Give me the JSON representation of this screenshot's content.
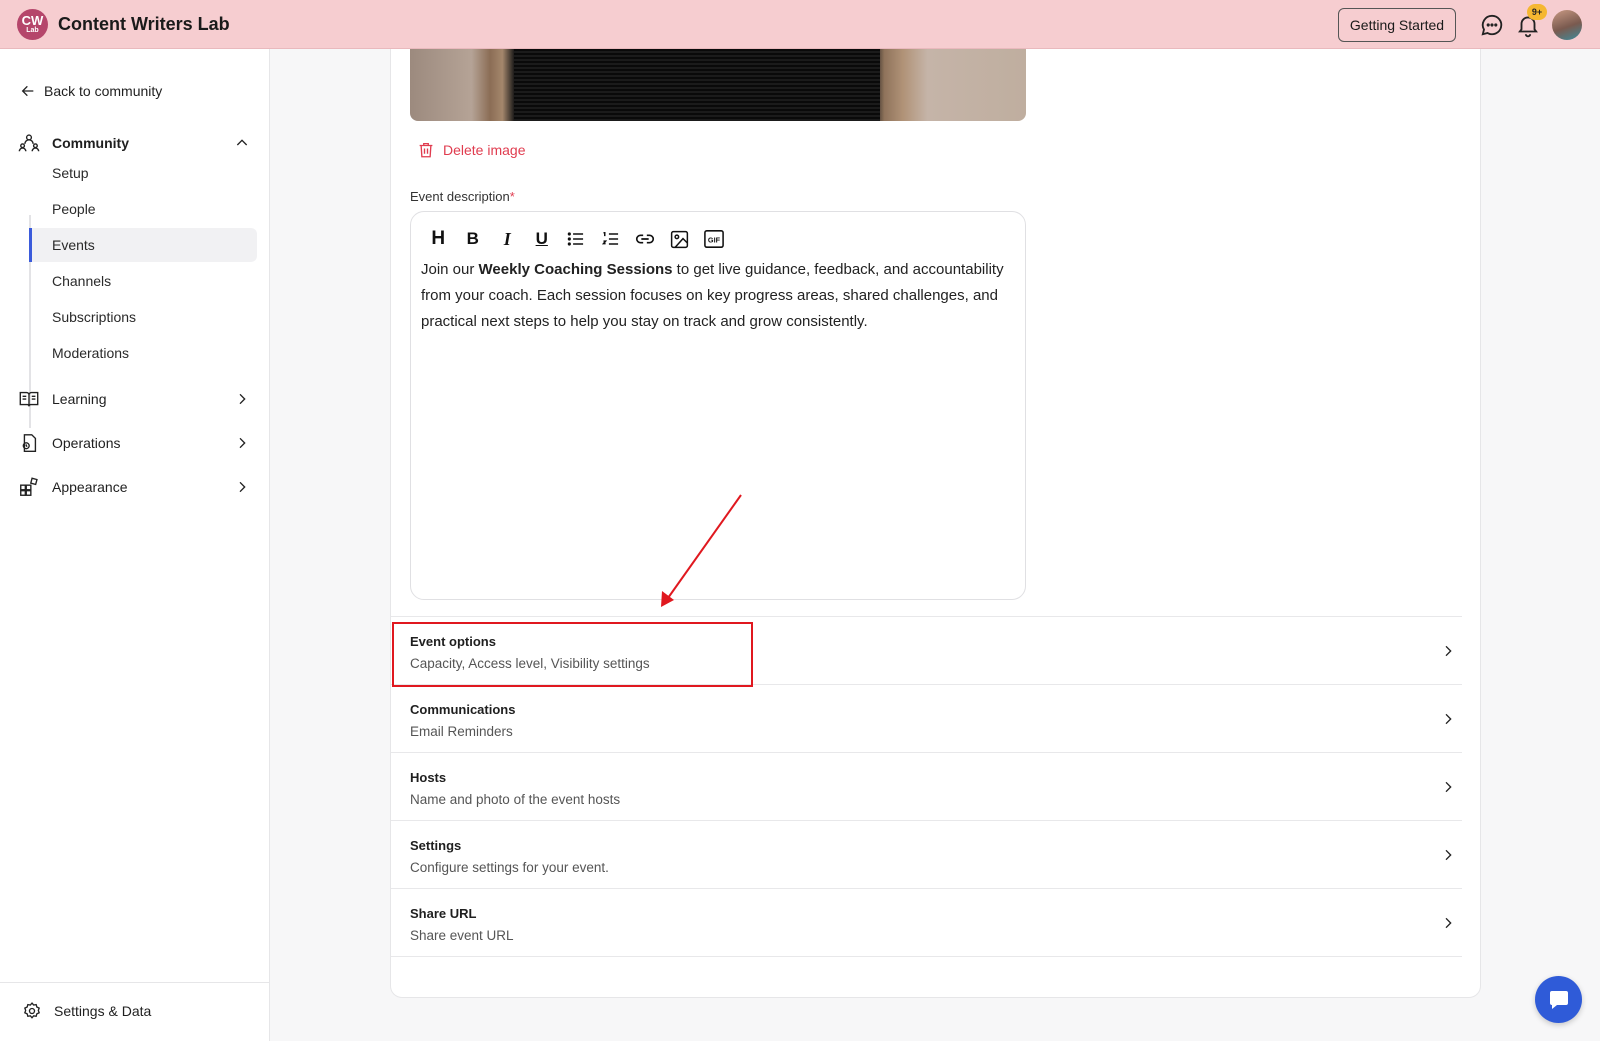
{
  "header": {
    "logo_top": "CW",
    "logo_bottom": "Lab",
    "title": "Content Writers Lab",
    "getting_started_label": "Getting Started",
    "notification_badge": "9+",
    "icons": [
      "chat-bubble-icon",
      "bell-icon"
    ]
  },
  "sidebar": {
    "back_label": "Back to community",
    "sections": [
      {
        "label": "Community",
        "icon": "community-icon",
        "expanded": true
      },
      {
        "label": "Learning",
        "icon": "book-icon",
        "expanded": false
      },
      {
        "label": "Operations",
        "icon": "operations-icon",
        "expanded": false
      },
      {
        "label": "Appearance",
        "icon": "appearance-icon",
        "expanded": false
      }
    ],
    "community_items": [
      "Setup",
      "People",
      "Events",
      "Channels",
      "Subscriptions",
      "Moderations"
    ],
    "active_item": "Events",
    "settings_label": "Settings & Data"
  },
  "form": {
    "delete_image_label": "Delete image",
    "description_label": "Event description",
    "required_mark": "*",
    "toolbar": {
      "heading": "H",
      "bold": "B",
      "italic": "I",
      "underline": "U",
      "gif": "GIF"
    },
    "description": {
      "intro": "Join our ",
      "bold": "Weekly Coaching Sessions",
      "rest": " to get live guidance, feedback, and accountability from your coach. Each session focuses on key progress areas, shared challenges, and practical next steps to help you stay on track and grow consistently."
    },
    "options": [
      {
        "title": "Event options",
        "subtitle": "Capacity, Access level, Visibility settings"
      },
      {
        "title": "Communications",
        "subtitle": "Email Reminders"
      },
      {
        "title": "Hosts",
        "subtitle": "Name and photo of the event hosts"
      },
      {
        "title": "Settings",
        "subtitle": "Configure settings for your event."
      },
      {
        "title": "Share URL",
        "subtitle": "Share event URL"
      }
    ]
  },
  "colors": {
    "header_bg": "#f6cdd0",
    "accent": "#3b5bdb",
    "danger": "#e03c4f",
    "annotation": "#e0181f"
  }
}
